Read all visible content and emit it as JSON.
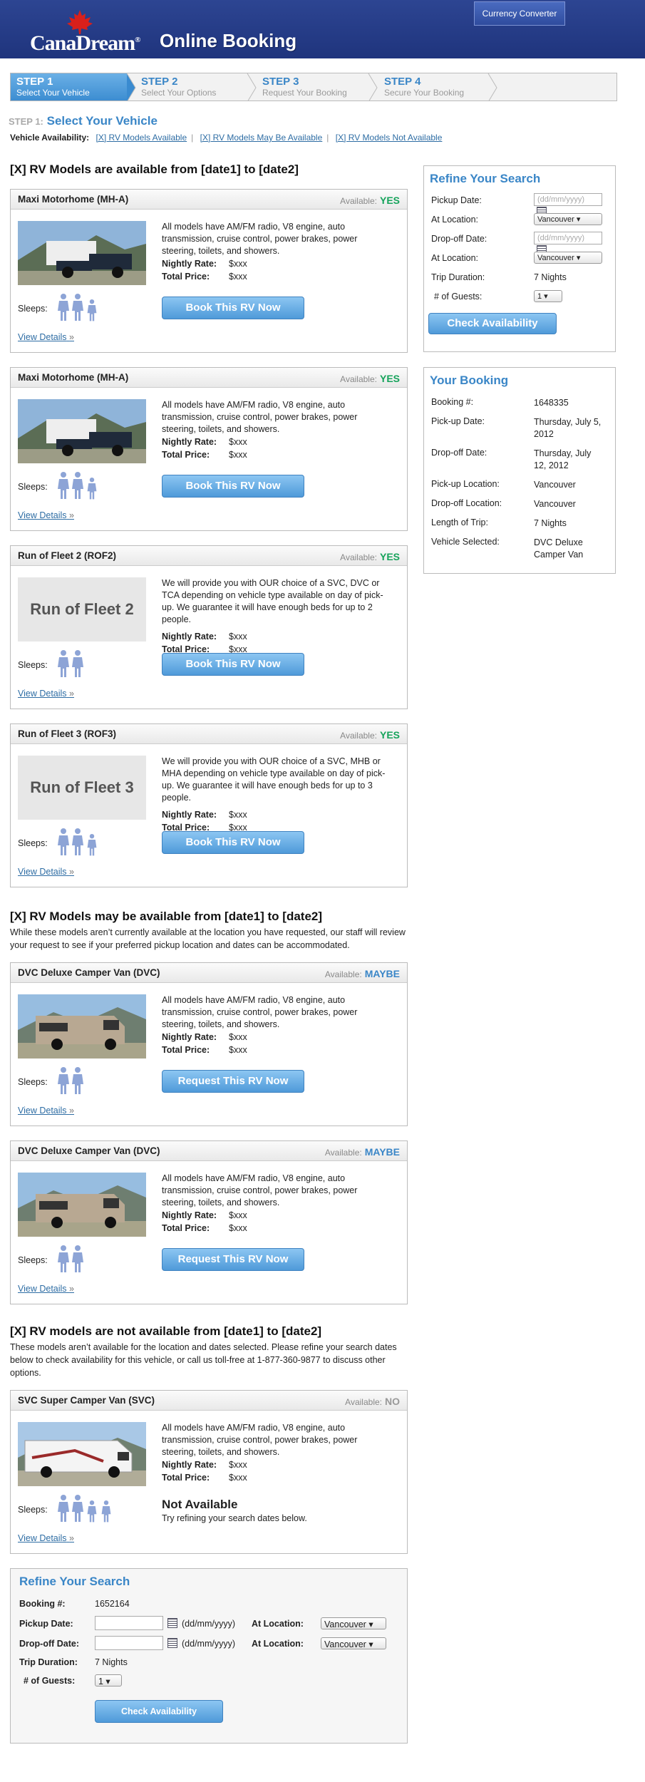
{
  "header": {
    "logo": "CanaDream",
    "logo_mark": "®",
    "title": "Online Booking",
    "currency_btn": "Currency Converter"
  },
  "steps": [
    {
      "num": "STEP 1",
      "label": "Select Your Vehicle"
    },
    {
      "num": "STEP 2",
      "label": "Select Your Options"
    },
    {
      "num": "STEP 3",
      "label": "Request Your Booking"
    },
    {
      "num": "STEP 4",
      "label": "Secure Your Booking"
    }
  ],
  "step1": {
    "prefix": "STEP 1:",
    "title": "Select Your Vehicle"
  },
  "availability": {
    "label": "Vehicle Availability:",
    "links": [
      "[X] RV Models Available",
      "[X] RV Models May Be Available",
      "[X] RV Models Not Available"
    ],
    "sep": "|"
  },
  "sections": {
    "available": {
      "title": "[X] RV Models are available from [date1] to [date2]"
    },
    "maybe": {
      "title": "[X] RV Models may be available from [date1] to [date2]",
      "intro": "While these models aren’t currently available at the location you have requested, our staff will review your request to see if your preferred pickup location and dates can be accommodated."
    },
    "not": {
      "title": "[X] RV models are not available from [date1] to [date2]",
      "intro": "These models aren’t available for the location and dates selected. Please refine your search dates below to check availability for this vehicle, or call us toll-free at 1-877-360-9877 to discuss other options."
    }
  },
  "common": {
    "available_label": "Available:",
    "sleeps": "Sleeps:",
    "nightly_label": "Nightly Rate:",
    "total_label": "Total Price:",
    "view_details": "View Details",
    "arrow": "»"
  },
  "vehicles": [
    {
      "name": "Maxi Motorhome (MH-A)",
      "status": "YES",
      "desc": "All models have AM/FM radio, V8 engine, auto transmission, cruise control, power brakes, power steering, toilets, and showers.",
      "nightly": "$xxx",
      "total": "$xxx",
      "button": "Book This RV Now",
      "people": "3",
      "thumb": "truck"
    },
    {
      "name": "Maxi Motorhome (MH-A)",
      "status": "YES",
      "desc": "All models have AM/FM radio, V8 engine, auto transmission, cruise control, power brakes, power steering, toilets, and showers.",
      "nightly": "$xxx",
      "total": "$xxx",
      "button": "Book This RV Now",
      "people": "3",
      "thumb": "truck"
    },
    {
      "name": "Run of Fleet 2 (ROF2)",
      "status": "YES",
      "desc": "We will provide you with OUR choice of a SVC, DVC or TCA depending on vehicle type available on day of pick-up. We guarantee it will have enough beds for up to 2 people.",
      "nightly": "$xxx",
      "total": "$xxx",
      "button": "Book This RV Now",
      "people": "2",
      "thumb_text": "Run of Fleet 2"
    },
    {
      "name": "Run of Fleet 3 (ROF3)",
      "status": "YES",
      "desc": "We will provide you with OUR choice of a SVC, MHB or MHA depending on vehicle type available on day of pick-up.  We guarantee it will have enough beds for up to 3 people.",
      "nightly": "$xxx",
      "total": "$xxx",
      "button": "Book This RV Now",
      "people": "3",
      "thumb_text": "Run of Fleet 3"
    },
    {
      "name": "DVC Deluxe Camper Van (DVC)",
      "status": "MAYBE",
      "desc": "All models have AM/FM radio, V8 engine, auto transmission, cruise control, power brakes, power steering, toilets, and showers.",
      "nightly": "$xxx",
      "total": "$xxx",
      "button": "Request This RV Now",
      "people": "2",
      "thumb": "van"
    },
    {
      "name": "DVC Deluxe Camper Van (DVC)",
      "status": "MAYBE",
      "desc": "All models have AM/FM radio, V8 engine, auto transmission, cruise control, power brakes, power steering, toilets, and showers.",
      "nightly": "$xxx",
      "total": "$xxx",
      "button": "Request This RV Now",
      "people": "2",
      "thumb": "van"
    },
    {
      "name": "SVC Super Camper Van (SVC)",
      "status": "NO",
      "desc": "All models have AM/FM radio, V8 engine, auto transmission, cruise control, power brakes, power steering, toilets, and showers.",
      "nightly": "$xxx",
      "total": "$xxx",
      "not_available": "Not Available",
      "not_available_sub": "Try refining your search dates below.",
      "people": "4",
      "thumb": "rv"
    }
  ],
  "refine": {
    "title": "Refine Your Search",
    "pickup_date": "Pickup Date:",
    "at_location": "At Location:",
    "dropoff_date": "Drop-off Date:",
    "trip_duration": "Trip Duration:",
    "guests": "# of Guests:",
    "date_placeholder": "(dd/mm/yyyy)",
    "location": "Vancouver",
    "duration": "7 Nights",
    "guests_value": "1",
    "button": "Check Availability"
  },
  "your_booking": {
    "title": "Your Booking",
    "rows": [
      {
        "label": "Booking #:",
        "value": "1648335"
      },
      {
        "label": "Pick-up Date:",
        "value": "Thursday, July 5, 2012"
      },
      {
        "label": "Drop-off Date:",
        "value": "Thursday, July 12, 2012"
      },
      {
        "label": "Pick-up Location:",
        "value": "Vancouver"
      },
      {
        "label": "Drop-off Location:",
        "value": "Vancouver"
      },
      {
        "label": "Length of Trip:",
        "value": "7 Nights"
      },
      {
        "label": "Vehicle Selected:",
        "value": "DVC Deluxe Camper Van"
      }
    ]
  },
  "bottom_refine": {
    "title": "Refine Your Search",
    "booking_label": "Booking #:",
    "booking": "1652164",
    "pickup_date": "Pickup Date:",
    "dropoff_date": "Drop-off Date:",
    "at_location": "At Location:",
    "trip_duration": "Trip Duration:",
    "duration": "7 Nights",
    "guests": "# of Guests:",
    "guests_value": "1",
    "date_format": "(dd/mm/yyyy)",
    "location": "Vancouver",
    "button": "Check Availability"
  }
}
